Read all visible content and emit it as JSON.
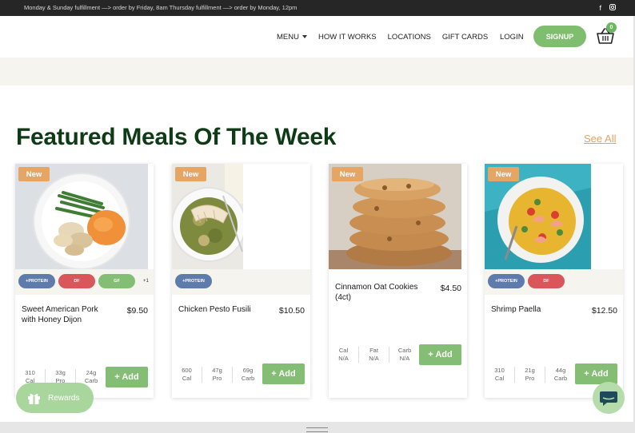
{
  "announcement": {
    "text": "Monday & Sunday fulfillment —> order by Friday, 8am Thursday fulfillment —> order by Monday, 12pm"
  },
  "nav": {
    "menu": "MENU",
    "how_it_works": "HOW IT WORKS",
    "locations": "LOCATIONS",
    "gift_cards": "GIFT CARDS",
    "login": "LOGIN",
    "signup": "SIGNUP",
    "cart_count": "0"
  },
  "section": {
    "title": "Featured Meals Of The Week",
    "see_all": "See All"
  },
  "cards": [
    {
      "badge": "New",
      "tags": [
        "+PROTEIN",
        "DF",
        "GF"
      ],
      "more": "+1",
      "name": "Sweet American Pork with Honey Dijon",
      "price": "$9.50",
      "macros": [
        [
          "310",
          "Cal"
        ],
        [
          "33g",
          "Pro"
        ],
        [
          "24g",
          "Carb"
        ]
      ],
      "add": "+ Add"
    },
    {
      "badge": "New",
      "tags": [
        "+PROTEIN"
      ],
      "name": "Chicken Pesto Fusili",
      "price": "$10.50",
      "macros": [
        [
          "600",
          "Cal"
        ],
        [
          "47g",
          "Pro"
        ],
        [
          "69g",
          "Carb"
        ]
      ],
      "add": "+ Add"
    },
    {
      "badge": "New",
      "tags": [],
      "name": "Cinnamon Oat Cookies (4ct)",
      "price": "$4.50",
      "macros": [
        [
          "Cal",
          "N/A"
        ],
        [
          "Fat",
          "N/A"
        ],
        [
          "Carb",
          "N/A"
        ]
      ],
      "add": "+ Add"
    },
    {
      "badge": "New",
      "tags": [
        "+PROTEIN",
        "DF"
      ],
      "name": "Shrimp Paella",
      "price": "$12.50",
      "macros": [
        [
          "310",
          "Cal"
        ],
        [
          "21g",
          "Pro"
        ],
        [
          "44g",
          "Carb"
        ]
      ],
      "add": "+ Add"
    }
  ],
  "rewards": {
    "label": "Rewards"
  },
  "colors": {
    "accent_green": "#84be74",
    "title_green": "#0e3b16",
    "badge_orange": "#e5a565",
    "protein_blue": "#5f7bab",
    "df_red": "#d9565a"
  }
}
